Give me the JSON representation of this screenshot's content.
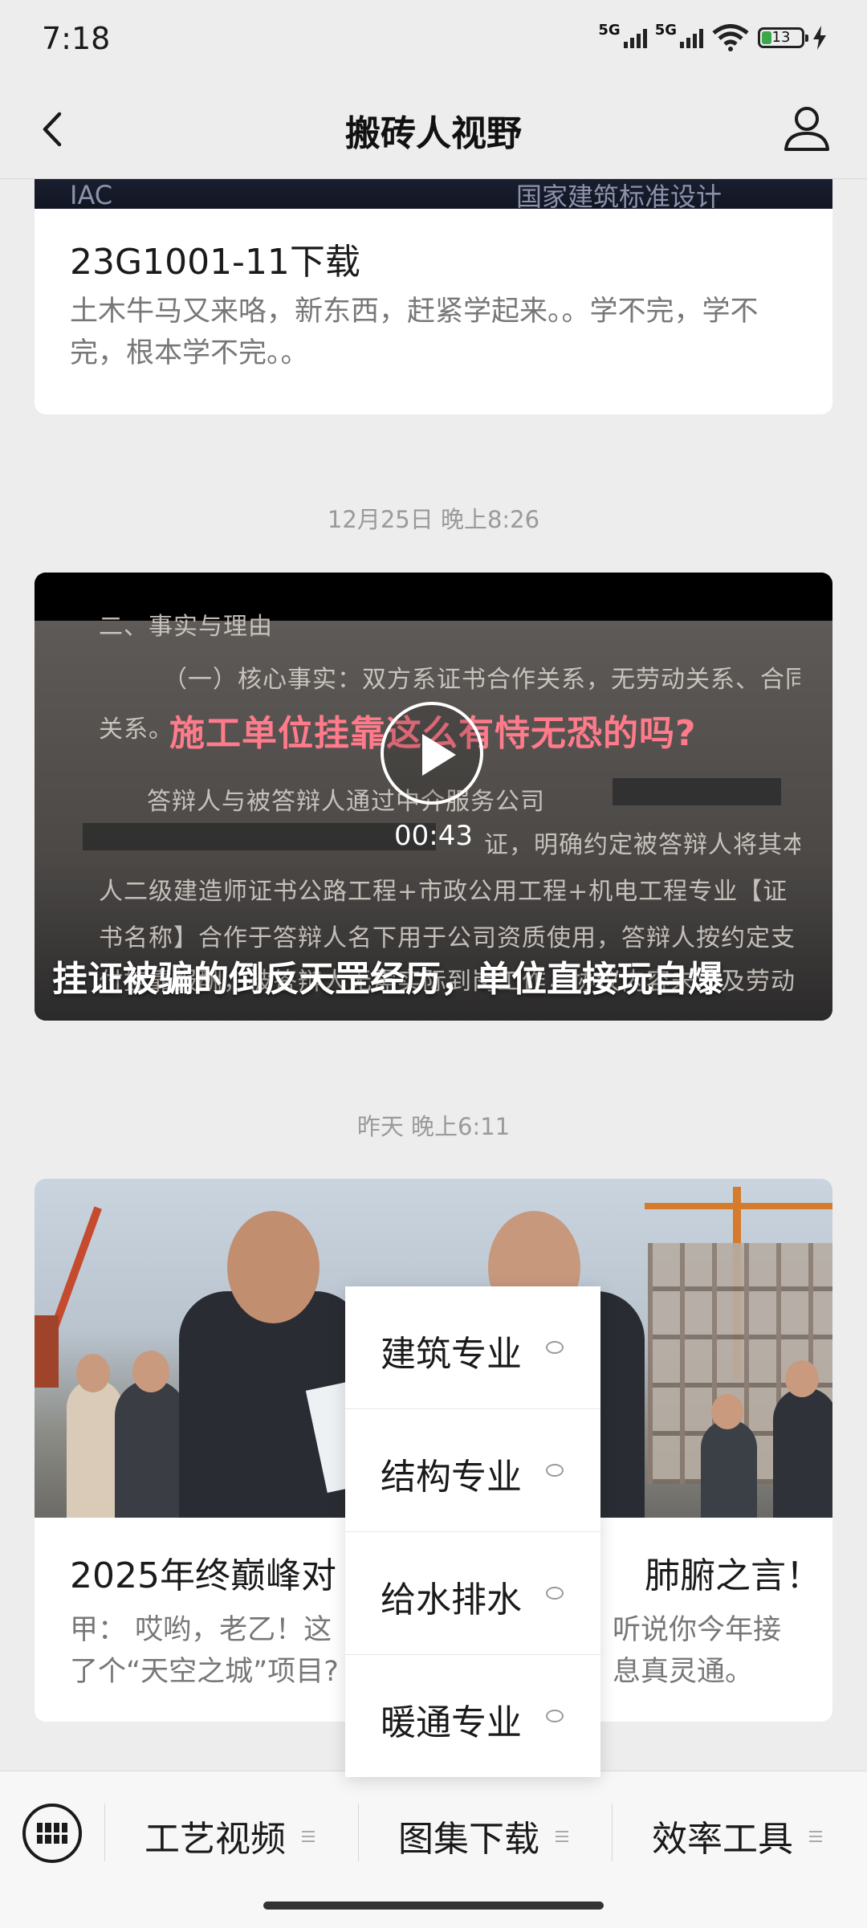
{
  "status_bar": {
    "time": "7:18",
    "network_1": "5G",
    "network_2": "5G",
    "battery_level": "13"
  },
  "nav": {
    "title": "搬砖人视野"
  },
  "article_1": {
    "image_text_left": "IAC",
    "image_text_right": "国家建筑标准设计",
    "title": "23G1001-11下载",
    "description": "土木牛马又来咯，新东西，赶紧学起来。。学不完，学不完，根本学不完。。"
  },
  "date_1": "12月25日 晚上8:26",
  "video": {
    "doc_lines": [
      "二、事实与理由",
      "（一）核心事实：双方系证书合作关系，无劳动关系、合同",
      "关系。",
      "答辩人与被答辩人通过中介服务公司",
      "证，明确约定被答辩人将其本",
      "人二级建造师证书公路工程+市政公用工程+机电工程专业【证",
      "书名称】合作于答辩人名下用于公司资质使用，答辩人按约定支",
      "付挂靠报酬，被答辩人无需实际到岗工作，协议内容未涉及劳动"
    ],
    "overlay_caption": "施工单位挂靠这么有恃无恐的吗?",
    "duration": "00:43",
    "title": "挂证被骗的倒反天罡经历，单位直接玩自爆"
  },
  "date_2": "昨天 晚上6:11",
  "article_3": {
    "title_left": "2025年终巅峰对",
    "title_right": "肺腑之言！",
    "desc_line1_left": "甲：  哎哟，老乙！这",
    "desc_line1_right": "听说你今年接",
    "desc_line2_left": "了个“天空之城”项目?",
    "desc_line2_right": "息真灵通。"
  },
  "popup_menu": {
    "items": [
      {
        "label": "建筑专业",
        "icon": "chat-bubble-icon"
      },
      {
        "label": "结构专业",
        "icon": "chat-bubble-icon"
      },
      {
        "label": "给水排水",
        "icon": "chat-bubble-icon"
      },
      {
        "label": "暖通专业",
        "icon": "chat-bubble-icon"
      }
    ]
  },
  "bottom_menu": {
    "items": [
      {
        "label": "工艺视频"
      },
      {
        "label": "图集下载"
      },
      {
        "label": "效率工具"
      }
    ]
  },
  "colors": {
    "background": "#ededed",
    "battery_green": "#3aa84a",
    "caption_red": "#ff7a8a"
  }
}
